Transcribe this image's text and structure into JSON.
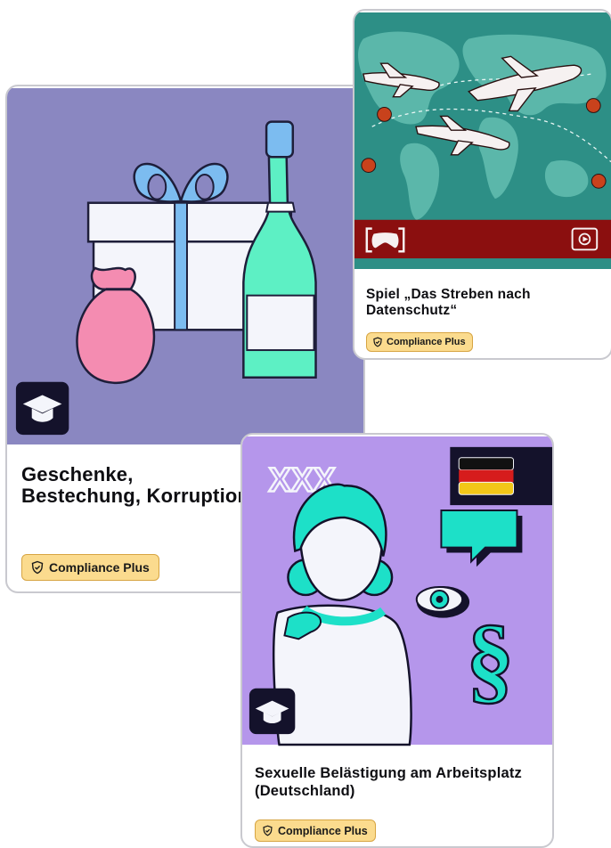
{
  "cards": [
    {
      "id": "gifts",
      "title": "Geschenke, Bestechung, Korruption",
      "badge": "Compliance Plus",
      "type_icon": "graduation-cap-icon",
      "art_background": "#8a87c1"
    },
    {
      "id": "game",
      "title": "Spiel „Das Streben nach Datenschutz“",
      "badge": "Compliance Plus",
      "type_icons": [
        "gamepad-icon",
        "video-play-icon"
      ],
      "art_background": "#2d8f86"
    },
    {
      "id": "harassment",
      "title": "Sexuelle Belästigung am Arbeitsplatz (Deutschland)",
      "badge": "Compliance Plus",
      "type_icon": "graduation-cap-icon",
      "flag_icon": "germany-flag-icon",
      "art_text": "XXX",
      "art_background": "#b596eb"
    }
  ],
  "colors": {
    "badge_bg": "#fbdb8e",
    "badge_border": "#d7a543",
    "banner_red": "#8b0f0f"
  }
}
